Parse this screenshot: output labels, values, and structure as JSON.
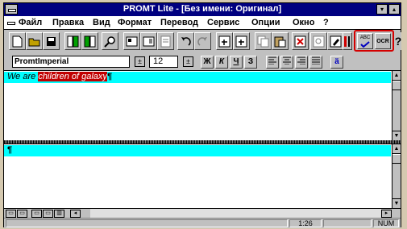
{
  "window": {
    "title": "PROMT Lite - [Без имени: Оригинал]",
    "min_glyph": "▾",
    "max_glyph": "▴"
  },
  "menu": {
    "items": [
      "Файл",
      "Правка",
      "Вид",
      "Формат",
      "Перевод",
      "Сервис",
      "Опции",
      "Окно",
      "?"
    ]
  },
  "toolbar": {
    "icons": [
      "new-document-icon",
      "open-document-icon",
      "save-icon",
      "translate-document-icon",
      "translate-selection-icon",
      "find-icon",
      "template-icon",
      "insert-icon",
      "glossary-icon",
      "undo-icon",
      "redo-icon",
      "first-page-icon",
      "last-page-icon",
      "copy-icon",
      "paste-icon",
      "delete-icon",
      "dictionary-icon",
      "edit-icon",
      "columns-icon"
    ],
    "spell_check_label": "ABC",
    "ocr_label": "OCR",
    "help_label": "?"
  },
  "format_toolbar": {
    "font_name": "PromtImperial",
    "font_size": "12",
    "bold_label": "Ж",
    "italic_label": "К",
    "underline_label": "Ч",
    "strike_label": "З",
    "font_spin": "±",
    "size_spin": "±",
    "replace_label": "ä"
  },
  "source_pane": {
    "text_plain": "We are ",
    "text_selected": "children of galaxy",
    "end_mark": "¶"
  },
  "target_pane": {
    "end_mark": "¶"
  },
  "status": {
    "position": "1:26",
    "num": "NUM"
  },
  "colors": {
    "title_bg": "#000080",
    "highlight_line": "#00ffff",
    "selection": "#c00000",
    "callout": "#d40000"
  }
}
